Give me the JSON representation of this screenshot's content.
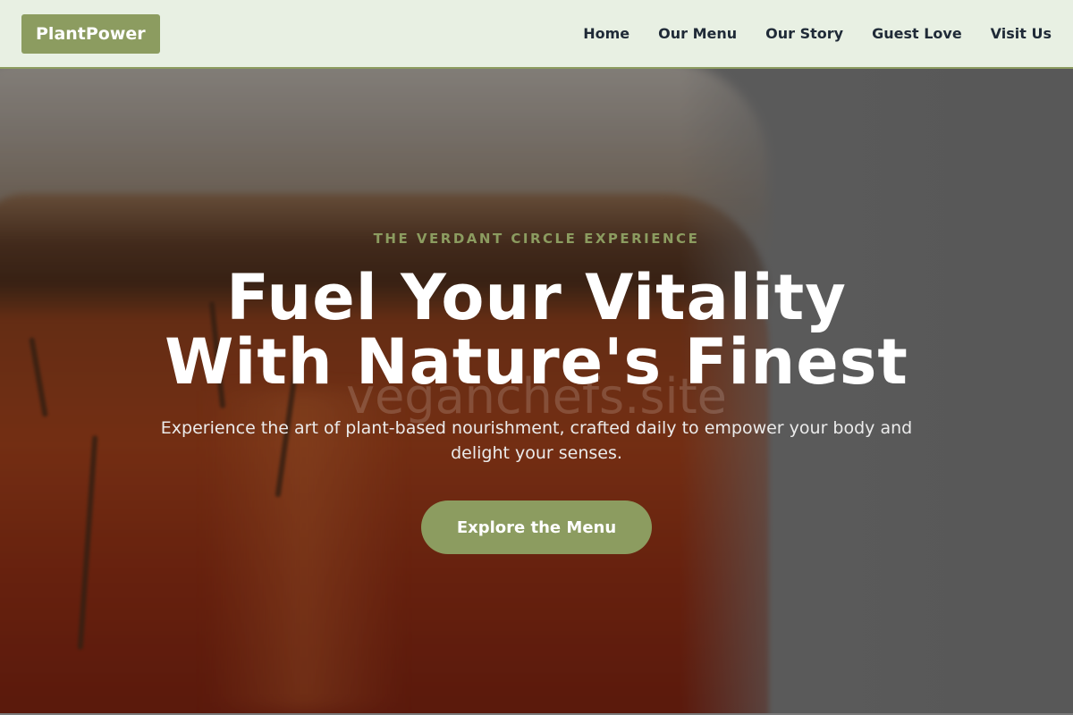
{
  "brand": {
    "logo_text": "PlantPower"
  },
  "nav": {
    "items": [
      {
        "label": "Home"
      },
      {
        "label": "Our Menu"
      },
      {
        "label": "Our Story"
      },
      {
        "label": "Guest Love"
      },
      {
        "label": "Visit Us"
      }
    ]
  },
  "hero": {
    "eyebrow": "THE VERDANT CIRCLE EXPERIENCE",
    "headline_line1": "Fuel Your Vitality",
    "headline_line2": "With Nature's Finest",
    "subtitle": "Experience the art of plant-based nourishment, crafted daily to empower your body and delight your senses.",
    "cta_label": "Explore the Menu",
    "watermark": "veganchefs.site"
  },
  "colors": {
    "accent": "#8c9c60",
    "nav_background": "#e8f0e3",
    "nav_text": "#1f2a37",
    "headline": "#ffffff"
  }
}
